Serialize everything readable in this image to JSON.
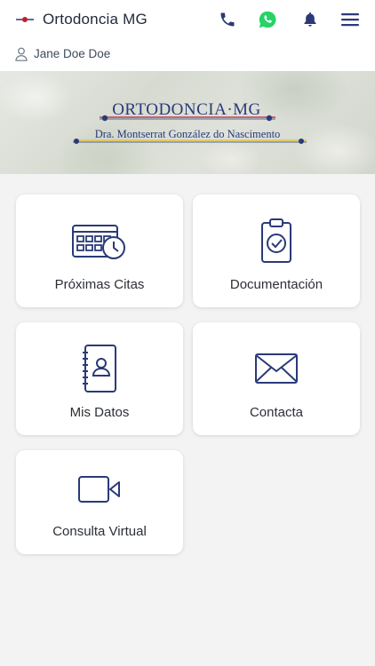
{
  "header": {
    "title": "Ortodoncia MG",
    "icons": [
      "phone-icon",
      "whatsapp-icon",
      "bell-icon",
      "menu-icon"
    ],
    "colors": {
      "brand": "#2a3a78",
      "accent": "#c0202a",
      "whatsapp": "#25d366",
      "icon": "#2a3a78"
    }
  },
  "user": {
    "name": "Jane Doe Doe",
    "icon": "user-icon"
  },
  "banner": {
    "brand_name": "ORTODONCIA·MG",
    "doctor": "Dra. Montserrat González do Nascimento"
  },
  "tiles": [
    {
      "label": "Próximas Citas",
      "icon": "calendar-clock-icon"
    },
    {
      "label": "Documentación",
      "icon": "clipboard-check-icon"
    },
    {
      "label": "Mis Datos",
      "icon": "contacts-book-icon"
    },
    {
      "label": "Contacta",
      "icon": "envelope-icon"
    },
    {
      "label": "Consulta Virtual",
      "icon": "video-camera-icon"
    }
  ]
}
